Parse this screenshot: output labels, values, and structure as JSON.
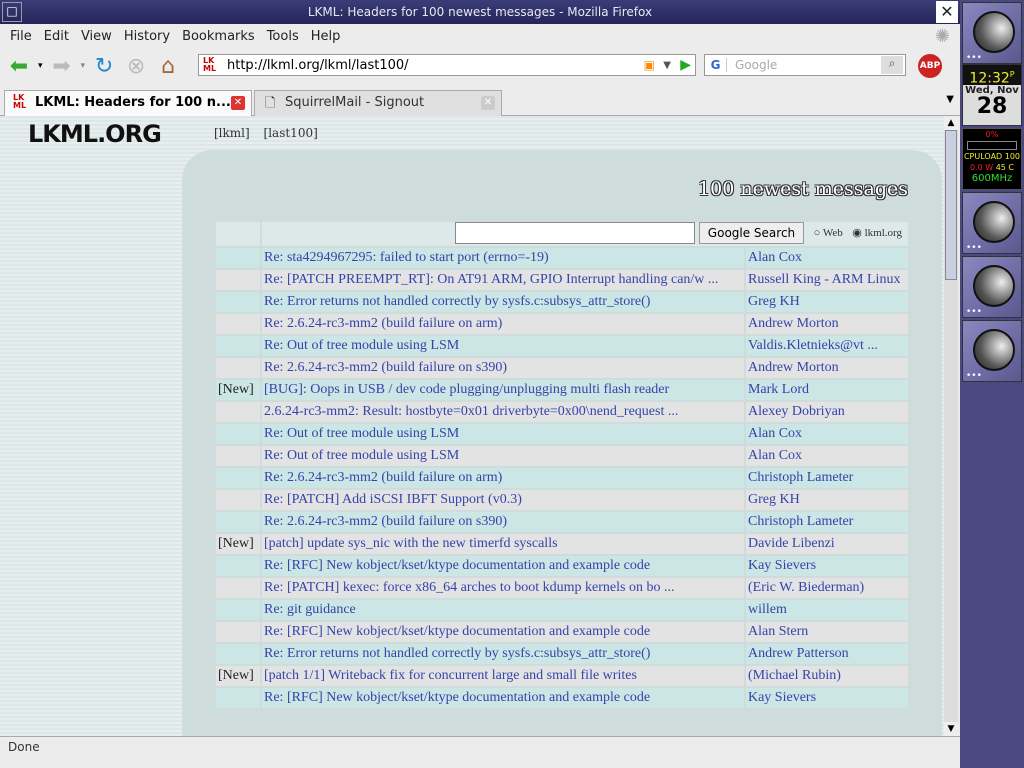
{
  "window": {
    "title": "LKML: Headers for 100 newest messages - Mozilla Firefox",
    "close": "✕"
  },
  "menu": [
    "File",
    "Edit",
    "View",
    "History",
    "Bookmarks",
    "Tools",
    "Help"
  ],
  "nav": {
    "url": "http://lkml.org/lkml/last100/",
    "search_placeholder": "Google",
    "abp": "ABP"
  },
  "tabs": [
    {
      "label": "LKML: Headers for 100 n...",
      "active": true
    },
    {
      "label": "SquirrelMail - Signout",
      "active": false
    }
  ],
  "page": {
    "logo": "LKML.ORG",
    "links": [
      "[lkml]",
      "[last100]"
    ],
    "heading": "100 newest messages",
    "search": {
      "button": "Google Search",
      "options": [
        "Web",
        "lkml.org"
      ],
      "selected": "lkml.org",
      "value": ""
    },
    "rows": [
      {
        "new": "",
        "subject": "Re: sta4294967295: failed to start port (errno=-19)",
        "author": "Alan Cox"
      },
      {
        "new": "",
        "subject": "Re: [PATCH PREEMPT_RT]: On AT91 ARM, GPIO Interrupt handling can/w ...",
        "author": "Russell King - ARM Linux"
      },
      {
        "new": "",
        "subject": "Re: Error returns not handled correctly by sysfs.c:subsys_attr_store()",
        "author": "Greg KH"
      },
      {
        "new": "",
        "subject": "Re: 2.6.24-rc3-mm2 (build failure on arm)",
        "author": "Andrew Morton"
      },
      {
        "new": "",
        "subject": "Re: Out of tree module using LSM",
        "author": "Valdis.Kletnieks@vt ..."
      },
      {
        "new": "",
        "subject": "Re: 2.6.24-rc3-mm2 (build failure on s390)",
        "author": "Andrew Morton"
      },
      {
        "new": "[New]",
        "subject": "[BUG]: Oops in USB / dev code plugging/unplugging multi flash reader",
        "author": "Mark Lord"
      },
      {
        "new": "",
        "subject": "2.6.24-rc3-mm2: Result: hostbyte=0x01 driverbyte=0x00\\nend_request ...",
        "author": "Alexey Dobriyan"
      },
      {
        "new": "",
        "subject": "Re: Out of tree module using LSM",
        "author": "Alan Cox"
      },
      {
        "new": "",
        "subject": "Re: Out of tree module using LSM",
        "author": "Alan Cox"
      },
      {
        "new": "",
        "subject": "Re: 2.6.24-rc3-mm2 (build failure on arm)",
        "author": "Christoph Lameter"
      },
      {
        "new": "",
        "subject": "Re: [PATCH] Add iSCSI IBFT Support (v0.3)",
        "author": "Greg KH"
      },
      {
        "new": "",
        "subject": "Re: 2.6.24-rc3-mm2 (build failure on s390)",
        "author": "Christoph Lameter"
      },
      {
        "new": "[New]",
        "subject": "[patch] update sys_nic with the new timerfd syscalls",
        "author": "Davide Libenzi"
      },
      {
        "new": "",
        "subject": "Re: [RFC] New kobject/kset/ktype documentation and example code",
        "author": "Kay Sievers"
      },
      {
        "new": "",
        "subject": "Re: [PATCH] kexec: force x86_64 arches to boot kdump kernels on bo ...",
        "author": "(Eric W. Biederman)"
      },
      {
        "new": "",
        "subject": "Re: git guidance",
        "author": "willem"
      },
      {
        "new": "",
        "subject": "Re: [RFC] New kobject/kset/ktype documentation and example code",
        "author": "Alan Stern"
      },
      {
        "new": "",
        "subject": "Re: Error returns not handled correctly by sysfs.c:subsys_attr_store()",
        "author": "Andrew Patterson"
      },
      {
        "new": "[New]",
        "subject": "[patch 1/1] Writeback fix for concurrent large and small file writes",
        "author": "(Michael Rubin)"
      },
      {
        "new": "",
        "subject": "Re: [RFC] New kobject/kset/ktype documentation and example code",
        "author": "Kay Sievers"
      }
    ]
  },
  "status": "Done",
  "dock": {
    "time": "12:32",
    "ampm": "P",
    "day": "Wed, Nov",
    "date": "28",
    "cpu": {
      "pct": "0%",
      "load": "CPULOAD 100",
      "watts": "0.0 W",
      "temp": "45 C",
      "freq": "600MHz"
    }
  }
}
